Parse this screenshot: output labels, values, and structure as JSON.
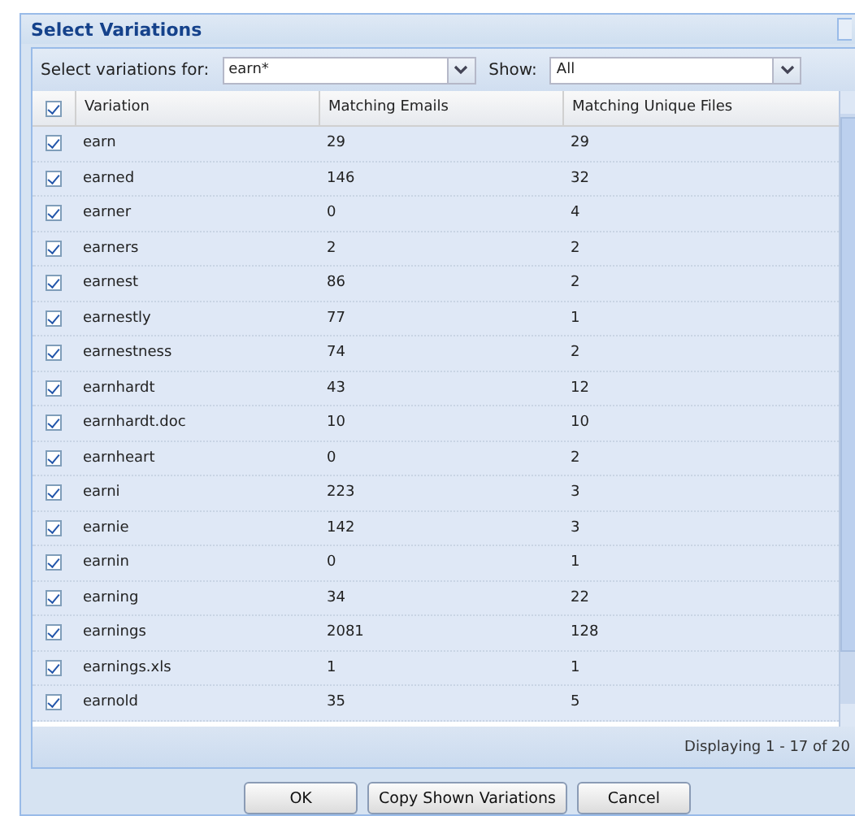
{
  "window": {
    "title": "Select Variations"
  },
  "toolbar": {
    "variations_label": "Select variations for:",
    "variations_value": "earn*",
    "show_label": "Show:",
    "show_value": "All"
  },
  "table": {
    "all_checked": true,
    "columns": [
      "Variation",
      "Matching Emails",
      "Matching Unique Files"
    ],
    "rows": [
      {
        "checked": true,
        "cells": [
          "earn",
          "29",
          "29"
        ]
      },
      {
        "checked": true,
        "cells": [
          "earned",
          "146",
          "32"
        ]
      },
      {
        "checked": true,
        "cells": [
          "earner",
          "0",
          "4"
        ]
      },
      {
        "checked": true,
        "cells": [
          "earners",
          "2",
          "2"
        ]
      },
      {
        "checked": true,
        "cells": [
          "earnest",
          "86",
          "2"
        ]
      },
      {
        "checked": true,
        "cells": [
          "earnestly",
          "77",
          "1"
        ]
      },
      {
        "checked": true,
        "cells": [
          "earnestness",
          "74",
          "2"
        ]
      },
      {
        "checked": true,
        "cells": [
          "earnhardt",
          "43",
          "12"
        ]
      },
      {
        "checked": true,
        "cells": [
          "earnhardt.doc",
          "10",
          "10"
        ]
      },
      {
        "checked": true,
        "cells": [
          "earnheart",
          "0",
          "2"
        ]
      },
      {
        "checked": true,
        "cells": [
          "earni",
          "223",
          "3"
        ]
      },
      {
        "checked": true,
        "cells": [
          "earnie",
          "142",
          "3"
        ]
      },
      {
        "checked": true,
        "cells": [
          "earnin",
          "0",
          "1"
        ]
      },
      {
        "checked": true,
        "cells": [
          "earning",
          "34",
          "22"
        ]
      },
      {
        "checked": true,
        "cells": [
          "earnings",
          "2081",
          "128"
        ]
      },
      {
        "checked": true,
        "cells": [
          "earnings.xls",
          "1",
          "1"
        ]
      },
      {
        "checked": true,
        "cells": [
          "earnold",
          "35",
          "5"
        ]
      }
    ]
  },
  "status": "Displaying 1 - 17 of 20",
  "buttons": [
    "OK",
    "Copy Shown Variations",
    "Cancel"
  ]
}
